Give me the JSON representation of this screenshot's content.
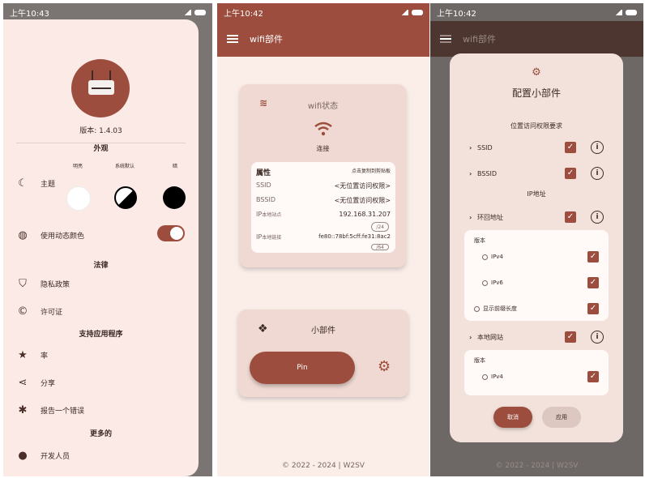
{
  "colors": {
    "accent": "#9c4d3d",
    "surface": "#fbeae6",
    "card": "#efd9d2",
    "dim_overlay": "#6d6866"
  },
  "panel1": {
    "status": {
      "time": "上午10:43"
    },
    "version": "版本: 1.4.03",
    "appearance_title": "外观",
    "theme_options": [
      "明亮",
      "系统默认",
      "暗"
    ],
    "theme_label": "主题",
    "dynamic_color_label": "使用动态颜色",
    "legal_title": "法律",
    "privacy_label": "隐私政策",
    "license_label": "许可证",
    "support_title": "支持应用程序",
    "rate_label": "率",
    "share_label": "分享",
    "bug_label": "报告一个错误",
    "more_title": "更多的",
    "dev_label": "开发人员"
  },
  "panel2": {
    "status": {
      "time": "上午10:42"
    },
    "appbar_title": "wifi部件",
    "wifi_card": {
      "title": "wifi状态",
      "state": "连接",
      "prop_header": "属性",
      "prop_hint": "点击复制到剪贴板",
      "rows": [
        {
          "key": "SSID",
          "value": "<无位置访问权限>"
        },
        {
          "key": "BSSID",
          "value": "<无位置访问权限>"
        },
        {
          "key": "IP",
          "sub": "本地站点",
          "value": "192.168.31.207",
          "badge": "/24"
        },
        {
          "key": "IP",
          "sub": "本地链接",
          "value": "fe80::78bf:5cff:fe31:8ac2",
          "badge": "/64"
        }
      ]
    },
    "widget_card": {
      "title": "小部件",
      "pin_label": "Pin"
    },
    "footer": "© 2022 - 2024 | W2SV"
  },
  "panel3": {
    "status": {
      "time": "上午10:42"
    },
    "appbar_title": "wifi部件",
    "dialog_title": "配置小部件",
    "location_section": "位置访问权限要求",
    "ssid_label": "SSID",
    "bssid_label": "BSSID",
    "ip_section": "IP地址",
    "loopback_label": "环回地址",
    "version_label": "版本",
    "ipv4": "IPv4",
    "ipv6": "IPv6",
    "prefix_label": "显示前缀长度",
    "local_site_label": "本地网站",
    "version_label2": "版本",
    "ipv4_2": "IPv4",
    "cancel": "取消",
    "apply": "应用",
    "footer": "© 2022 - 2024 | W2SV"
  }
}
